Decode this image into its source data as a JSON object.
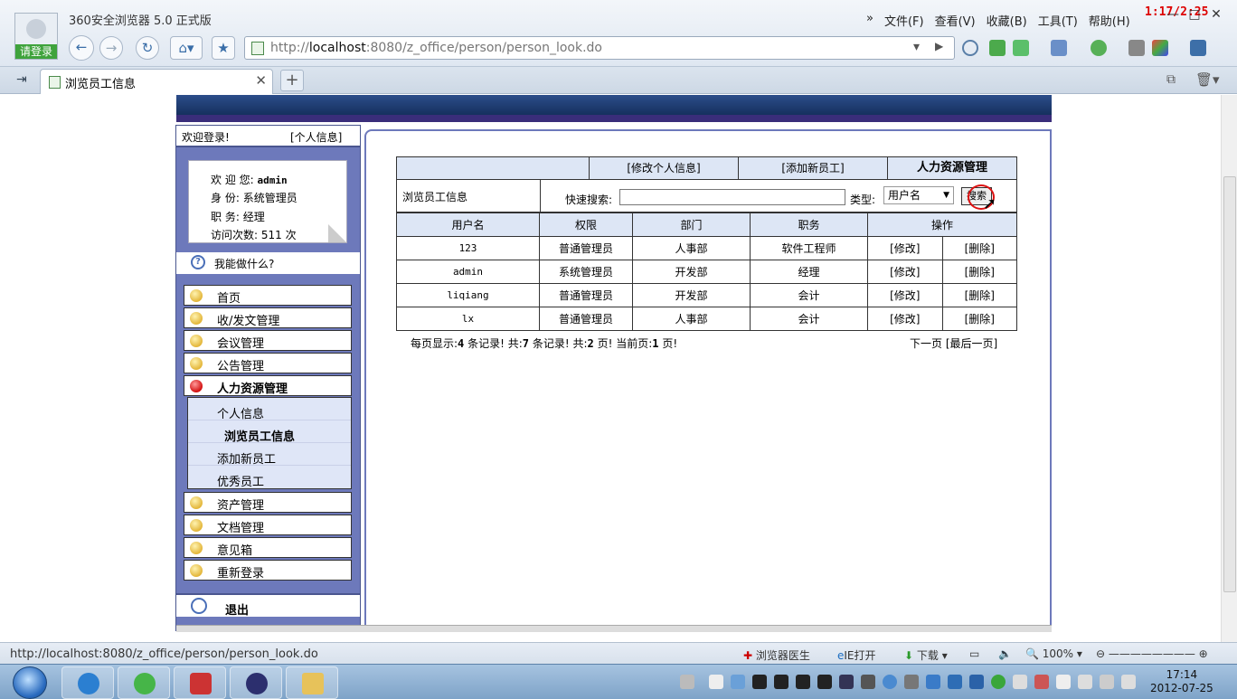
{
  "browser": {
    "app_title": "360安全浏览器 5.0 正式版",
    "login_label": "请登录",
    "menu": [
      "文件(F)",
      "查看(V)",
      "收藏(B)",
      "工具(T)",
      "帮助(H)"
    ],
    "timer_overlay": "1:17/2:25",
    "url_prefix": "http://",
    "url_host": "localhost",
    "url_rest": ":8080/z_office/person/person_look.do",
    "tab_title": "浏览员工信息",
    "new_tab_label": "+"
  },
  "sidebar": {
    "welcome": "欢迎登录!",
    "personal_info_link": "[个人信息]",
    "user": {
      "welcome_label": "欢 迎 您:",
      "username": "admin",
      "identity_label": "身    份:",
      "identity": "系统管理员",
      "position_label": "职    务:",
      "position": "经理",
      "visits_label": "访问次数:",
      "visits": "511 次"
    },
    "help_label": "我能做什么?",
    "menu_items": [
      "首页",
      "收/发文管理",
      "会议管理",
      "公告管理",
      "人力资源管理"
    ],
    "sub_items": [
      "个人信息",
      "浏览员工信息",
      "添加新员工",
      "优秀员工"
    ],
    "menu_items_after": [
      "资产管理",
      "文档管理",
      "意见箱",
      "重新登录"
    ],
    "logout_label": "退出"
  },
  "content": {
    "topnav": [
      "[修改个人信息]",
      "[添加新员工]",
      "人力资源管理"
    ],
    "page_label": "浏览员工信息",
    "quick_search_label": "快速搜索:",
    "type_label": "类型:",
    "type_selected": "用户名",
    "search_button": "搜索",
    "columns": [
      "用户名",
      "权限",
      "部门",
      "职务",
      "操作"
    ],
    "rows": [
      {
        "username": "123",
        "role": "普通管理员",
        "dept": "人事部",
        "position": "软件工程师",
        "edit": "[修改]",
        "delete": "[删除]"
      },
      {
        "username": "admin",
        "role": "系统管理员",
        "dept": "开发部",
        "position": "经理",
        "edit": "[修改]",
        "delete": "[删除]"
      },
      {
        "username": "liqiang",
        "role": "普通管理员",
        "dept": "开发部",
        "position": "会计",
        "edit": "[修改]",
        "delete": "[删除]"
      },
      {
        "username": "lx",
        "role": "普通管理员",
        "dept": "人事部",
        "position": "会计",
        "edit": "[修改]",
        "delete": "[删除]"
      }
    ],
    "pager": {
      "per_page_prefix": "每页显示:",
      "per_page": "4",
      "records_total_prefix": "条记录! 共:",
      "records_total": "7",
      "pages_prefix": "条记录! 共:",
      "pages": "2",
      "current_prefix": "页! 当前页:",
      "current": "1",
      "current_suffix": "页!",
      "next": "下一页",
      "last": "[最后一页]"
    }
  },
  "statusbar": {
    "url": "http://localhost:8080/z_office/person/person_look.do",
    "doctor": "浏览器医生",
    "ie_open": "IE打开",
    "download": "下载",
    "zoom": "100%"
  },
  "taskbar": {
    "time": "17:14",
    "date": "2012-07-25"
  }
}
